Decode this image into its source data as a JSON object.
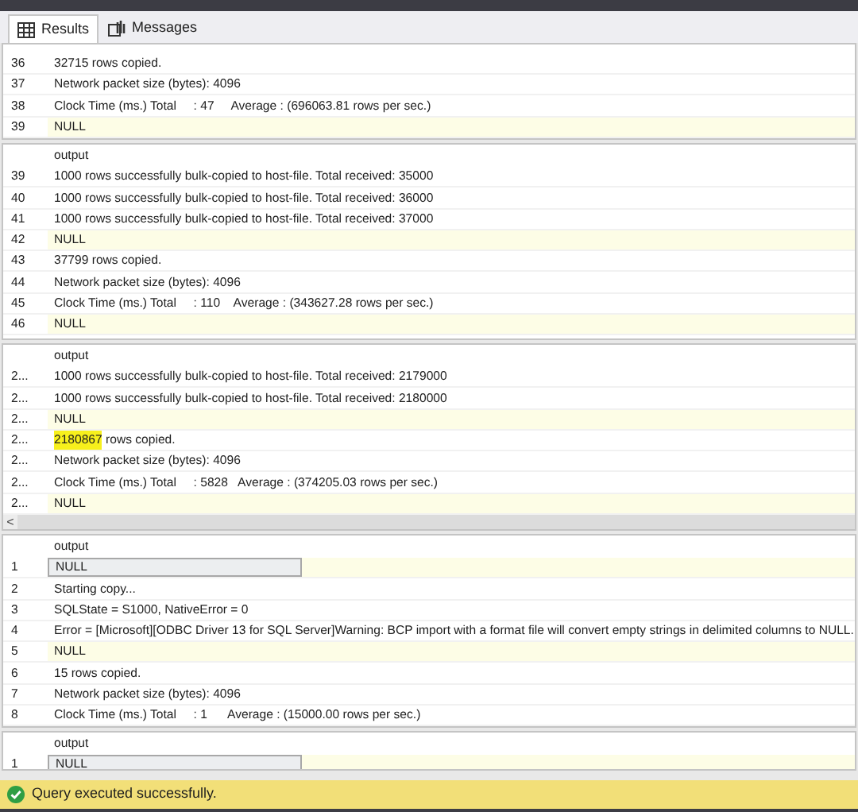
{
  "tabs": [
    {
      "label": "Results",
      "kind": "grid",
      "selected": true
    },
    {
      "label": "Messages",
      "kind": "messages",
      "selected": false
    }
  ],
  "panels": [
    {
      "rows": [
        {
          "num": "36",
          "kind": "text",
          "text": "32715 rows copied.",
          "selected": false
        },
        {
          "num": "37",
          "kind": "text",
          "text": "Network packet size (bytes): 4096",
          "selected": false
        },
        {
          "num": "38",
          "kind": "text",
          "text": "Clock Time (ms.) Total     : 47     Average : (696063.81 rows per sec.)",
          "selected": false
        },
        {
          "num": "39",
          "kind": "null",
          "text": "NULL",
          "selected": false
        }
      ]
    },
    {
      "header": "output",
      "rows": [
        {
          "num": "39",
          "kind": "text",
          "text": "1000 rows successfully bulk-copied to host-file. Total received: 35000",
          "selected": false
        },
        {
          "num": "40",
          "kind": "text",
          "text": "1000 rows successfully bulk-copied to host-file. Total received: 36000",
          "selected": false
        },
        {
          "num": "41",
          "kind": "text",
          "text": "1000 rows successfully bulk-copied to host-file. Total received: 37000",
          "selected": false
        },
        {
          "num": "42",
          "kind": "null",
          "text": "NULL",
          "selected": false
        },
        {
          "num": "43",
          "kind": "text",
          "text": "37799 rows copied.",
          "selected": false
        },
        {
          "num": "44",
          "kind": "text",
          "text": "Network packet size (bytes): 4096",
          "selected": false
        },
        {
          "num": "45",
          "kind": "text",
          "text": "Clock Time (ms.) Total     : 110    Average : (343627.28 rows per sec.)",
          "selected": false
        },
        {
          "num": "46",
          "kind": "null",
          "text": "NULL",
          "selected": false
        }
      ]
    },
    {
      "header": "output",
      "scroll_left": "<",
      "rows": [
        {
          "num": "2...",
          "kind": "text",
          "text": "1000 rows successfully bulk-copied to host-file. Total received: 2179000",
          "selected": false
        },
        {
          "num": "2...",
          "kind": "text",
          "text": "1000 rows successfully bulk-copied to host-file. Total received: 2180000",
          "selected": false
        },
        {
          "num": "2...",
          "kind": "null",
          "text": "NULL",
          "selected": false
        },
        {
          "num": "2...",
          "kind": "text",
          "highlight": "2180867",
          "text": " rows copied.",
          "selected": false
        },
        {
          "num": "2...",
          "kind": "text",
          "text": "Network packet size (bytes): 4096",
          "selected": false
        },
        {
          "num": "2...",
          "kind": "text",
          "text": "Clock Time (ms.) Total     : 5828   Average : (374205.03 rows per sec.)",
          "selected": false
        },
        {
          "num": "2...",
          "kind": "null",
          "text": "NULL",
          "selected": false
        }
      ]
    },
    {
      "header": "output",
      "rows": [
        {
          "num": "1",
          "kind": "null",
          "text": "NULL",
          "selected": true
        },
        {
          "num": "2",
          "kind": "text",
          "text": "Starting copy...",
          "selected": false
        },
        {
          "num": "3",
          "kind": "text",
          "text": "SQLState = S1000, NativeError = 0",
          "selected": false
        },
        {
          "num": "4",
          "kind": "text",
          "text": "Error = [Microsoft][ODBC Driver 13 for SQL Server]Warning: BCP import with a format file will convert empty strings in delimited columns to NULL.",
          "selected": false
        },
        {
          "num": "5",
          "kind": "null",
          "text": "NULL",
          "selected": false
        },
        {
          "num": "6",
          "kind": "text",
          "text": "15 rows copied.",
          "selected": false
        },
        {
          "num": "7",
          "kind": "text",
          "text": "Network packet size (bytes): 4096",
          "selected": false
        },
        {
          "num": "8",
          "kind": "text",
          "text": "Clock Time (ms.) Total     : 1      Average : (15000.00 rows per sec.)",
          "selected": false
        }
      ]
    },
    {
      "header": "output",
      "rows": [
        {
          "num": "1",
          "kind": "null",
          "text": "NULL",
          "selected": true
        }
      ]
    }
  ],
  "status": {
    "text": "Query executed successfully."
  }
}
